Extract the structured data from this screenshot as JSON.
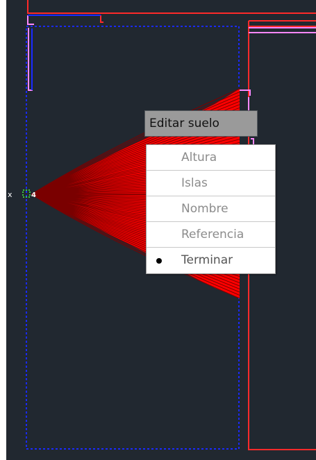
{
  "prompt": {
    "title": "Editar suelo"
  },
  "menu": {
    "options": [
      {
        "label": "Altura",
        "selected": false
      },
      {
        "label": "Islas",
        "selected": false
      },
      {
        "label": "Nombre",
        "selected": false
      },
      {
        "label": "Referencia",
        "selected": false
      },
      {
        "label": "Terminar",
        "selected": true
      }
    ]
  },
  "canvas": {
    "marker_label": "4",
    "cursor_glyph": "x",
    "colors": {
      "background": "#212830",
      "floor_fill": "#ff0000",
      "wall_lines": "#ff2a2a",
      "selection_outline": "#1a2aff",
      "pink_lines": "#ff88ff",
      "marker": "#44ff44"
    }
  }
}
